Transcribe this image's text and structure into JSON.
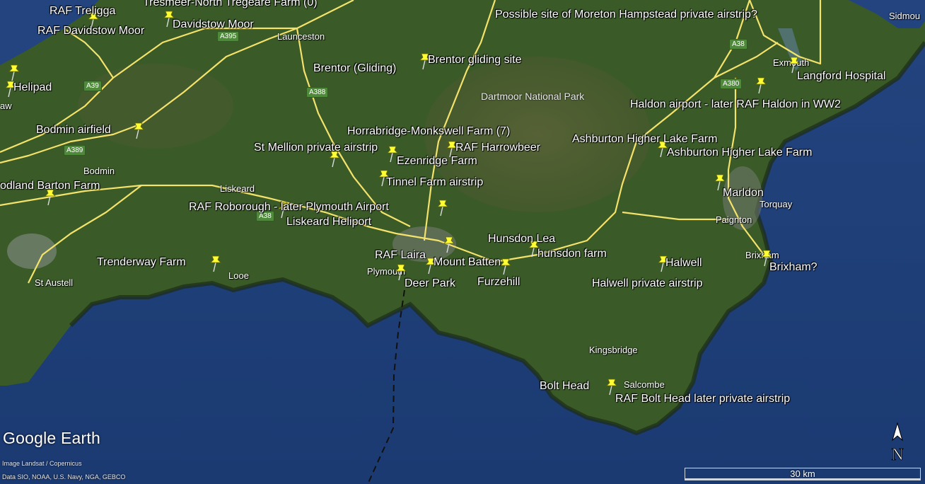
{
  "map": {
    "colors": {
      "sea": "#21407a",
      "land": "#3d5a2a",
      "moor": "#4e5c36",
      "road": "#f3e26b",
      "pin": "#ffff33"
    },
    "labels": [
      {
        "id": "raf-treligga",
        "text": "RAF Treligga"
      },
      {
        "id": "raf-davidstow-moor",
        "text": "RAF Davidstow Moor"
      },
      {
        "id": "tresmeer",
        "text": "Tresmeer-North Tregeare Farm (0)"
      },
      {
        "id": "davidstow-moor",
        "text": "Davidstow Moor"
      },
      {
        "id": "moreton",
        "text": "Possible site of Moreton Hampstead private airstrip?"
      },
      {
        "id": "brentor-gliding-site",
        "text": "Brentor gliding site"
      },
      {
        "id": "brentor-gliding",
        "text": "Brentor (Gliding)"
      },
      {
        "id": "helipad",
        "text": "Helipad"
      },
      {
        "id": "langford",
        "text": "Langford Hospital"
      },
      {
        "id": "haldon",
        "text": "Haldon airport - later RAF Haldon in WW2"
      },
      {
        "id": "bodmin-airfield",
        "text": "Bodmin airfield"
      },
      {
        "id": "horrabridge",
        "text": "Horrabridge-Monkswell Farm (7)"
      },
      {
        "id": "ashburton-1",
        "text": "Ashburton Higher Lake Farm"
      },
      {
        "id": "st-mellion",
        "text": "St Mellion private airstrip"
      },
      {
        "id": "raf-harrowbeer",
        "text": "RAF Harrowbeer"
      },
      {
        "id": "ashburton-2",
        "text": "Ashburton Higher Lake Farm"
      },
      {
        "id": "ezenridge",
        "text": "Ezenridge Farm"
      },
      {
        "id": "tinnel",
        "text": "Tinnel Farm airstrip"
      },
      {
        "id": "marldon",
        "text": "Marldon"
      },
      {
        "id": "dland-barton",
        "text": "odland Barton Farm"
      },
      {
        "id": "raf-roborough",
        "text": "RAF Roborough - later Plymouth Airport"
      },
      {
        "id": "liskeard-heliport",
        "text": "Liskeard Heliport"
      },
      {
        "id": "hunsdon-lea",
        "text": "Hunsdon Lea"
      },
      {
        "id": "hunsdon-farm",
        "text": "hunsdon farm"
      },
      {
        "id": "raf-laira",
        "text": "RAF Laira"
      },
      {
        "id": "mount-batten",
        "text": "Mount Batten"
      },
      {
        "id": "trenderway",
        "text": "Trenderway Farm"
      },
      {
        "id": "halwell",
        "text": "Halwell"
      },
      {
        "id": "brixham",
        "text": "Brixham?"
      },
      {
        "id": "deer-park",
        "text": "Deer Park"
      },
      {
        "id": "furzehill",
        "text": "Furzehill"
      },
      {
        "id": "halwell-private",
        "text": "Halwell private airstrip"
      },
      {
        "id": "bolt-head",
        "text": "Bolt Head"
      },
      {
        "id": "raf-bolt-head",
        "text": "RAF Bolt Head later private airstrip"
      }
    ],
    "places": [
      {
        "id": "launceston",
        "text": "Launceston"
      },
      {
        "id": "bodmin",
        "text": "Bodmin"
      },
      {
        "id": "liskeard",
        "text": "Liskeard"
      },
      {
        "id": "st-austell",
        "text": "St Austell"
      },
      {
        "id": "looe",
        "text": "Looe"
      },
      {
        "id": "plymouth",
        "text": "Plymouth"
      },
      {
        "id": "kingsbridge",
        "text": "Kingsbridge"
      },
      {
        "id": "salcombe",
        "text": "Salcombe"
      },
      {
        "id": "torquay",
        "text": "Torquay"
      },
      {
        "id": "paignton",
        "text": "Paignton"
      },
      {
        "id": "brixham-town",
        "text": "Brixham"
      },
      {
        "id": "exmouth",
        "text": "Exmouth"
      },
      {
        "id": "sidmouth",
        "text": "Sidmou"
      },
      {
        "id": "law",
        "text": "aw"
      }
    ],
    "park": "Dartmoor National Park",
    "roads": [
      "A395",
      "A39",
      "A388",
      "A389",
      "A38",
      "A38",
      "A380"
    ],
    "logo": "Google Earth",
    "credits": [
      "Image Landsat / Copernicus",
      "Data SIO, NOAA, U.S. Navy, NGA, GEBCO"
    ],
    "scale": "30 km",
    "north": "N"
  }
}
